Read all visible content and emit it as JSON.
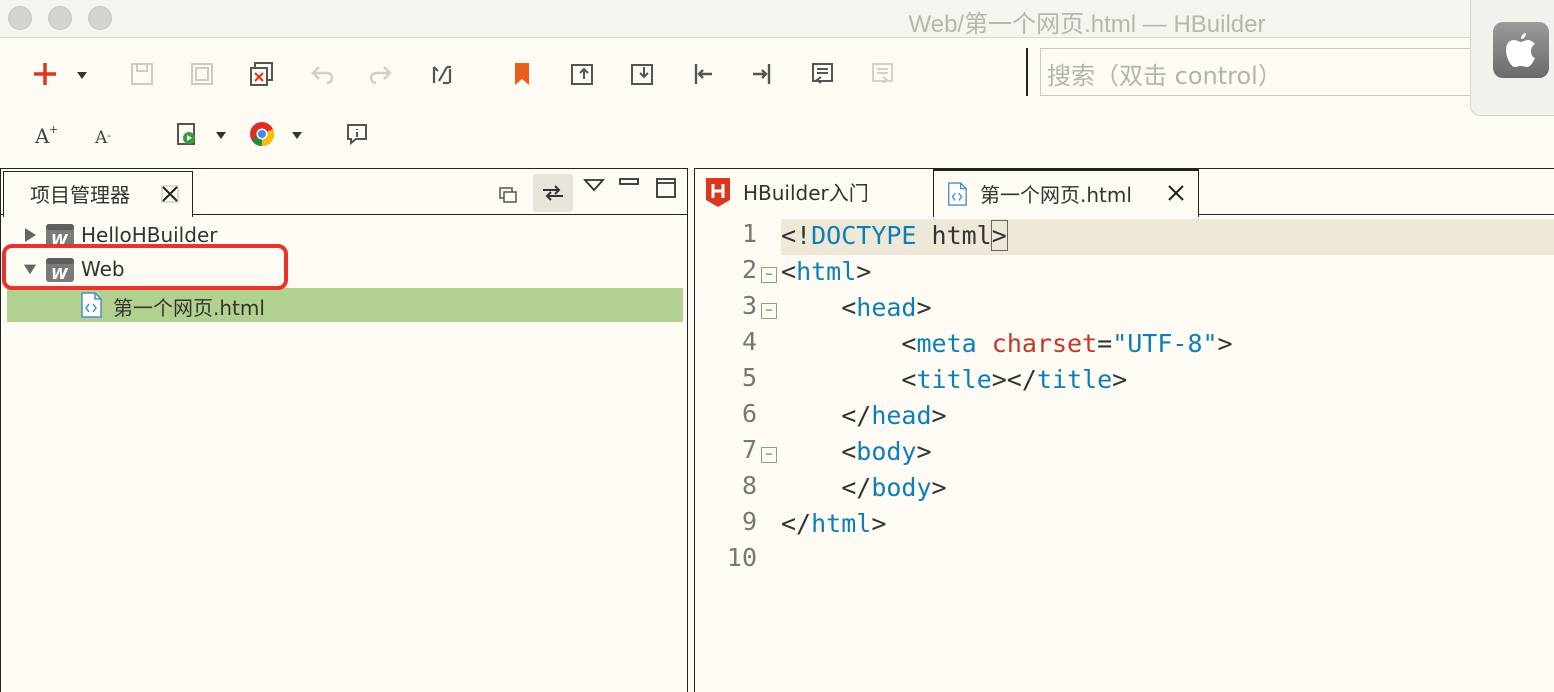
{
  "window": {
    "title": "Web/第一个网页.html  —  HBuilder"
  },
  "toolbar": {
    "row1_icons": [
      "new-icon",
      "save-icon",
      "save-all-icon",
      "save-as-icon",
      "undo-icon",
      "redo-icon",
      "format-icon",
      "bookmark-icon",
      "goto-previous-icon",
      "goto-next-icon",
      "jump-start-icon",
      "jump-end-icon",
      "wrap-icon",
      "unwrap-icon"
    ],
    "row2_icons": [
      "font-increase-icon",
      "font-decrease-icon",
      "run-icon",
      "chrome-icon",
      "info-icon"
    ],
    "search": {
      "placeholder": "搜索（双击 control）"
    }
  },
  "left_panel": {
    "tab_label": "项目管理器",
    "tree": [
      {
        "label": "HelloHBuilder",
        "type": "project",
        "expanded": false
      },
      {
        "label": "Web",
        "type": "project",
        "expanded": true
      },
      {
        "label": "第一个网页.html",
        "type": "file",
        "selected": true
      }
    ]
  },
  "editor": {
    "tabs": [
      {
        "label": "HBuilder入门",
        "active": false
      },
      {
        "label": "第一个网页.html",
        "active": true
      }
    ],
    "lines": [
      {
        "num": "1",
        "fold": false
      },
      {
        "num": "2",
        "fold": true
      },
      {
        "num": "3",
        "fold": true
      },
      {
        "num": "4",
        "fold": false
      },
      {
        "num": "5",
        "fold": false
      },
      {
        "num": "6",
        "fold": false
      },
      {
        "num": "7",
        "fold": true
      },
      {
        "num": "8",
        "fold": false
      },
      {
        "num": "9",
        "fold": false
      },
      {
        "num": "10",
        "fold": false
      }
    ],
    "code": {
      "l1": {
        "open": "<!",
        "tag": "DOCTYPE",
        "rest": " html",
        "close": ">"
      },
      "l2": {
        "open": "<",
        "tag": "html",
        "close": ">"
      },
      "l3": {
        "indent": "    ",
        "open": "<",
        "tag": "head",
        "close": ">"
      },
      "l4": {
        "indent": "        ",
        "open": "<",
        "tag": "meta",
        "sp": " ",
        "attr": "charset",
        "eq": "=",
        "val": "\"UTF-8\"",
        "close": ">"
      },
      "l5": {
        "indent": "        ",
        "open": "<",
        "tag": "title",
        "mid": "></",
        "tag2": "title",
        "close": ">"
      },
      "l6": {
        "indent": "    ",
        "open": "</",
        "tag": "head",
        "close": ">"
      },
      "l7": {
        "indent": "    ",
        "open": "<",
        "tag": "body",
        "close": ">"
      },
      "l8": {
        "indent": "    ",
        "open": "</",
        "tag": "body",
        "close": ">"
      },
      "l9": {
        "open": "</",
        "tag": "html",
        "close": ">"
      }
    }
  },
  "colors": {
    "tag": "#0e7fb5",
    "attr": "#c0392b",
    "selection": "#b2d18e",
    "highlight_box": "#e8342a"
  }
}
